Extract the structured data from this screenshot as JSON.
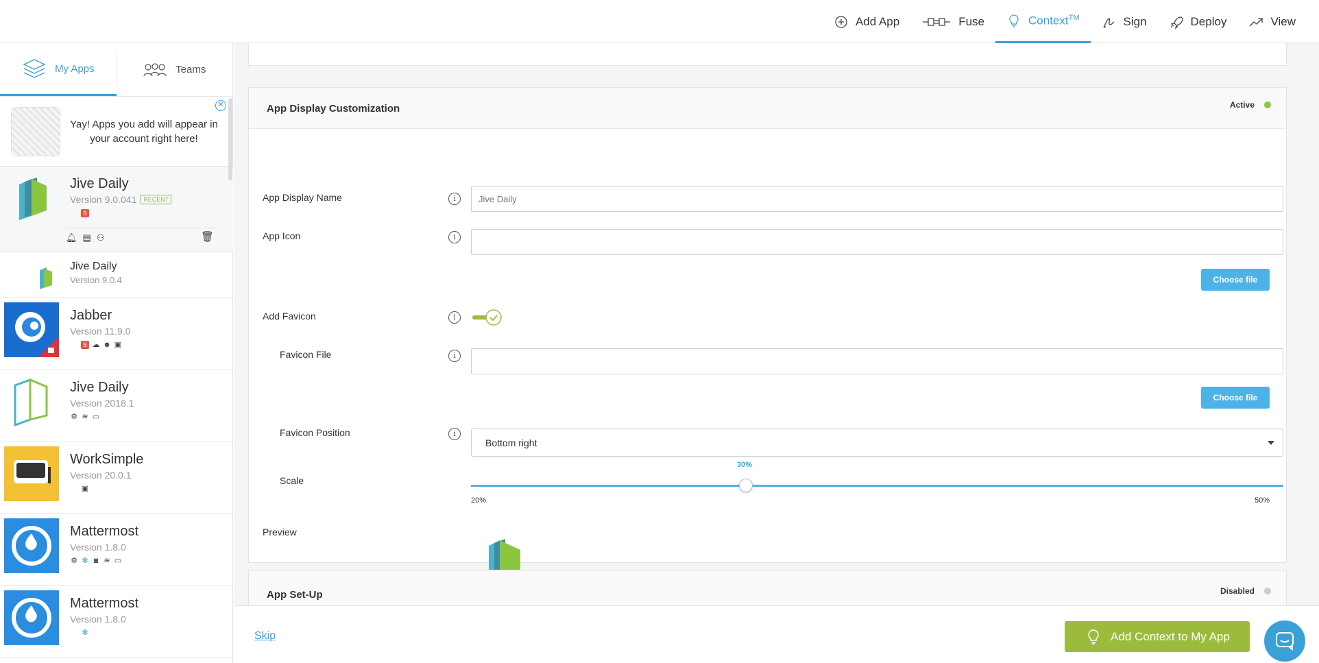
{
  "nav": {
    "add_app": "Add App",
    "fuse": "Fuse",
    "context": "Context",
    "context_sup": "TM",
    "sign": "Sign",
    "deploy": "Deploy",
    "view": "View"
  },
  "sidebar": {
    "tabs": {
      "my_apps": "My Apps",
      "teams": "Teams"
    },
    "notice": "Yay! Apps you add will appear in your account right here!",
    "apps": [
      {
        "name": "Jive Daily",
        "version": "Version 9.0.041",
        "badge": "RECENT"
      },
      {
        "name": "Jive Daily",
        "version": "Version 9.0.4"
      },
      {
        "name": "Jabber",
        "version": "Version 11.9.0"
      },
      {
        "name": "Jive Daily",
        "version": "Version 2018.1"
      },
      {
        "name": "WorkSimple",
        "version": "Version 20.0.1"
      },
      {
        "name": "Mattermost",
        "version": "Version 1.8.0"
      },
      {
        "name": "Mattermost",
        "version": "Version 1.8.0"
      }
    ]
  },
  "card": {
    "title": "App Display Customization",
    "status": "Active",
    "fields": {
      "display_name_label": "App Display Name",
      "display_name_placeholder": "Jive Daily",
      "app_icon_label": "App Icon",
      "choose_file": "Choose file",
      "add_favicon_label": "Add Favicon",
      "favicon_file_label": "Favicon File",
      "favicon_position_label": "Favicon Position",
      "favicon_position_value": "Bottom right",
      "scale_label": "Scale",
      "scale_value": "30%",
      "scale_min": "20%",
      "scale_max": "50%",
      "preview_label": "Preview"
    },
    "favicon_enabled": true,
    "scale_fraction": 0.3333
  },
  "card2": {
    "title": "App Set-Up",
    "status": "Disabled"
  },
  "footer": {
    "skip": "Skip",
    "cta": "Add Context to My App"
  },
  "colors": {
    "accent": "#3aa0d8",
    "cta": "#9cbb3c",
    "active_dot": "#8cc63f"
  }
}
